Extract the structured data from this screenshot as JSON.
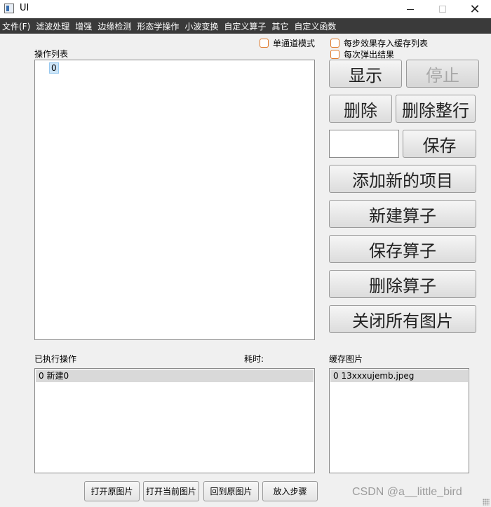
{
  "window": {
    "title": "UI"
  },
  "menu": [
    "文件(F)",
    "滤波处理",
    "增强",
    "边缘检测",
    "形态学操作",
    "小波变换",
    "自定义算子",
    "其它",
    "自定义函数"
  ],
  "checkboxes": {
    "single_channel": "单通道模式",
    "cache_each_step": "每步效果存入缓存列表",
    "popup_each": "每次弹出结果"
  },
  "op_list": {
    "label": "操作列表",
    "items": [
      "0"
    ]
  },
  "buttons": {
    "show": "显示",
    "stop": "停止",
    "delete": "删除",
    "delete_row": "删除整行",
    "save": "保存",
    "add_item": "添加新的项目",
    "new_operator": "新建算子",
    "save_operator": "保存算子",
    "delete_operator": "删除算子",
    "close_all_images": "关闭所有图片"
  },
  "save_input": {
    "value": ""
  },
  "executed": {
    "label": "已执行操作",
    "time_label": "耗时:",
    "items": [
      "0 新建0"
    ]
  },
  "cache": {
    "label": "缓存图片",
    "items": [
      "0 13xxxujemb.jpeg"
    ]
  },
  "bottom_buttons": {
    "open_original": "打开原图片",
    "open_current": "打开当前图片",
    "back_original": "回到原图片",
    "add_step": "放入步骤"
  },
  "watermark": "CSDN @a__little_bird"
}
